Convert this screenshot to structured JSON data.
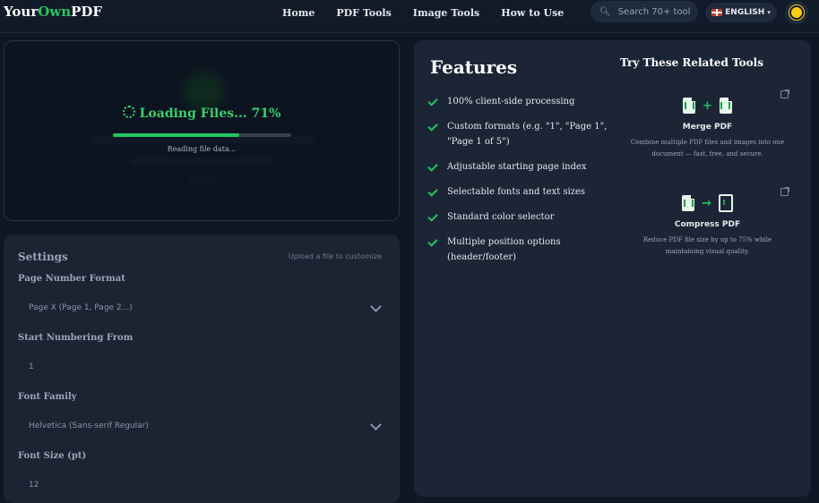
{
  "header": {
    "logo_your": "Your",
    "logo_own": "Own",
    "logo_pdf": "PDF",
    "nav": [
      "Home",
      "PDF Tools",
      "Image Tools",
      "How to Use"
    ],
    "search_placeholder": "Search 70+ tool",
    "language": "ENGLISH",
    "theme_icon": "sun-icon"
  },
  "loading": {
    "title": "Loading Files... 71%",
    "progress_percent": 71,
    "subtitle": "Reading file data..."
  },
  "settings": {
    "title": "Settings",
    "hint": "Upload a file to customize",
    "fields": [
      {
        "label": "Page Number Format",
        "value": "Page X (Page 1, Page 2...)",
        "type": "select"
      },
      {
        "label": "Start Numbering From",
        "value": "1",
        "type": "input"
      },
      {
        "label": "Font Family",
        "value": "Helvetica (Sans-serif Regular)",
        "type": "select"
      },
      {
        "label": "Font Size (pt)",
        "value": "12",
        "type": "input"
      }
    ]
  },
  "features": {
    "title": "Features",
    "items": [
      "100% client-side processing",
      "Custom formats (e.g. \"1\", \"Page 1\", \"Page 1 of 5\")",
      "Adjustable starting page index",
      "Selectable fonts and text sizes",
      "Standard color selector",
      "Multiple position options (header/footer)"
    ]
  },
  "related": {
    "title": "Try These Related Tools",
    "tools": [
      {
        "name": "Merge PDF",
        "description": "Combine multiple PDF files and images into one document — fast, free, and secure.",
        "icon": "merge-icon"
      },
      {
        "name": "Compress PDF",
        "description": "Reduce PDF file size by up to 75% while maintaining visual quality.",
        "icon": "compress-icon"
      }
    ]
  },
  "colors": {
    "accent": "#22c55e",
    "background": "#0f1726",
    "panel": "#1c2536"
  }
}
